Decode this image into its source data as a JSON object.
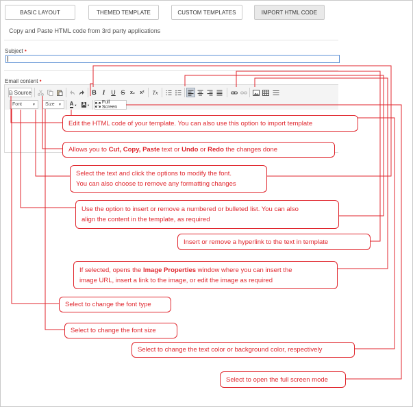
{
  "tabs": [
    {
      "label": "BASIC LAYOUT",
      "active": false
    },
    {
      "label": "THEMED TEMPLATE",
      "active": false
    },
    {
      "label": "CUSTOM TEMPLATES",
      "active": false
    },
    {
      "label": "IMPORT HTML CODE",
      "active": true
    }
  ],
  "subtitle": "Copy and Paste HTML code from 3rd party applications",
  "form": {
    "subject_label": "Subject",
    "subject_value": "",
    "content_label": "Email content",
    "required_mark": "•"
  },
  "toolbar": {
    "source_label": "Source",
    "bold": "B",
    "italic": "I",
    "underline": "U",
    "strike": "S",
    "subscript": "x₂",
    "superscript": "x²",
    "remove_format": "Tx",
    "font_label": "Font",
    "size_label": "Size",
    "text_color": "A",
    "bg_color": "A",
    "fullscreen_label": "Full Screen",
    "icons": [
      "source-icon",
      "cut-icon",
      "copy-icon",
      "paste-icon",
      "undo-icon",
      "redo-icon",
      "numbered-list-icon",
      "bulleted-list-icon",
      "align-left-icon",
      "align-center-icon",
      "align-right-icon",
      "justify-icon",
      "link-icon",
      "unlink-icon",
      "image-icon",
      "table-icon",
      "horizontal-rule-icon",
      "fullscreen-icon"
    ]
  },
  "callouts": {
    "source": [
      "Edit the HTML code of your template. You can also use this option to import template"
    ],
    "clipboard": {
      "pre": "Allows you to ",
      "cut": "Cut, ",
      "copy": "Copy, ",
      "paste": "Paste",
      "mid": " text or ",
      "undo": "Undo",
      "or": " or ",
      "redo": "Redo",
      "post": " the changes done"
    },
    "font": [
      "Select the text and click the options to modify the font.",
      "You can also choose to remove any formatting changes"
    ],
    "list": [
      "Use the option to insert or remove a numbered or bulleted list. You can also",
      "align the content in the template, as required"
    ],
    "link": [
      "Insert or remove a hyperlink to the text in template"
    ],
    "image": {
      "pre": "If selected, opens the ",
      "bold": "Image Properties",
      "post": " window where you can insert the",
      "line2": "image URL, insert a link to the image, or edit the image as required"
    },
    "font_type": [
      "Select to change the font type"
    ],
    "font_size": [
      "Select to change the font size"
    ],
    "color": [
      "Select to change the text color or background color, respectively"
    ],
    "fullscreen": [
      "Select to open the full screen mode"
    ]
  },
  "colors": {
    "callout": "#e0252c",
    "required": "#e53935",
    "input_border": "#5b8fd4"
  }
}
